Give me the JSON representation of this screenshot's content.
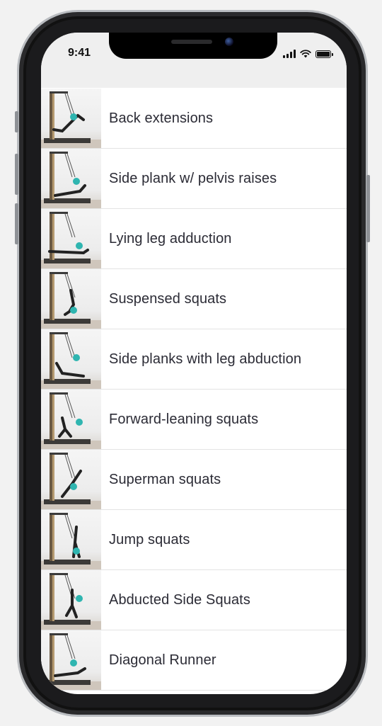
{
  "status_bar": {
    "time": "9:41",
    "icons": [
      "cellular-signal-icon",
      "wifi-icon",
      "battery-icon"
    ]
  },
  "exercises": [
    {
      "label": "Back extensions",
      "thumbnail": "exercise-thumbnail"
    },
    {
      "label": "Side plank w/ pelvis raises",
      "thumbnail": "exercise-thumbnail"
    },
    {
      "label": "Lying leg adduction",
      "thumbnail": "exercise-thumbnail"
    },
    {
      "label": "Suspensed squats",
      "thumbnail": "exercise-thumbnail"
    },
    {
      "label": "Side planks with leg abduction",
      "thumbnail": "exercise-thumbnail"
    },
    {
      "label": "Forward-leaning squats",
      "thumbnail": "exercise-thumbnail"
    },
    {
      "label": "Superman squats",
      "thumbnail": "exercise-thumbnail"
    },
    {
      "label": "Jump squats",
      "thumbnail": "exercise-thumbnail"
    },
    {
      "label": "Abducted Side Squats",
      "thumbnail": "exercise-thumbnail"
    },
    {
      "label": "Diagonal Runner",
      "thumbnail": "exercise-thumbnail"
    }
  ],
  "colors": {
    "row_text": "#2b2b35",
    "separator": "#e3e3e3",
    "status_bar_bg": "#efefef",
    "accent_outfit": "#2fb5b0"
  }
}
